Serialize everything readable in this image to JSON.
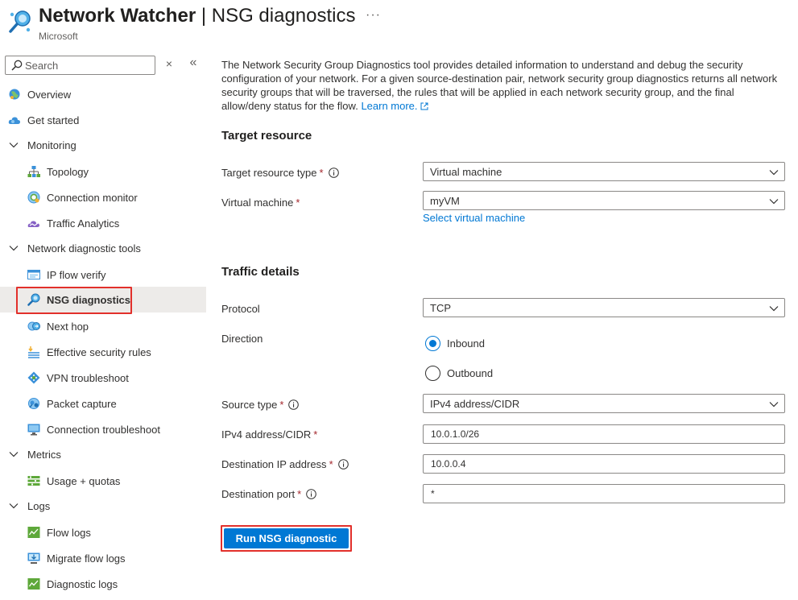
{
  "header": {
    "title_main": "Network Watcher",
    "title_sep": " | ",
    "title_blade": "NSG diagnostics",
    "more_label": "···",
    "subtitle": "Microsoft"
  },
  "sidebar": {
    "search_placeholder": "Search",
    "clear_label": "×",
    "collapse_label": "«",
    "items": [
      {
        "label": "Overview",
        "icon": "globe-icon"
      },
      {
        "label": "Get started",
        "icon": "cloud-icon"
      },
      {
        "label": "Monitoring",
        "icon": "chevron-down-icon"
      },
      {
        "label": "Topology",
        "icon": "topology-icon"
      },
      {
        "label": "Connection monitor",
        "icon": "connection-monitor-icon"
      },
      {
        "label": "Traffic Analytics",
        "icon": "traffic-analytics-icon"
      },
      {
        "label": "Network diagnostic tools",
        "icon": "chevron-down-icon"
      },
      {
        "label": "IP flow verify",
        "icon": "ip-flow-icon"
      },
      {
        "label": "NSG diagnostics",
        "icon": "nsg-diagnostics-icon",
        "selected": true
      },
      {
        "label": "Next hop",
        "icon": "next-hop-icon"
      },
      {
        "label": "Effective security rules",
        "icon": "security-rules-icon"
      },
      {
        "label": "VPN troubleshoot",
        "icon": "vpn-icon"
      },
      {
        "label": "Packet capture",
        "icon": "packet-capture-icon"
      },
      {
        "label": "Connection troubleshoot",
        "icon": "monitor-icon"
      },
      {
        "label": "Metrics",
        "icon": "chevron-down-icon"
      },
      {
        "label": "Usage + quotas",
        "icon": "usage-icon"
      },
      {
        "label": "Logs",
        "icon": "chevron-down-icon"
      },
      {
        "label": "Flow logs",
        "icon": "flow-logs-icon"
      },
      {
        "label": "Migrate flow logs",
        "icon": "migrate-icon"
      },
      {
        "label": "Diagnostic logs",
        "icon": "diagnostic-logs-icon"
      }
    ]
  },
  "content": {
    "intro": "The Network Security Group Diagnostics tool provides detailed information to understand and debug the security configuration of your network. For a given source-destination pair, network security group diagnostics returns all network security groups that will be traversed, the rules that will be applied in each network security group, and the final allow/deny status for the flow.",
    "learn_more": "Learn more.",
    "target_heading": "Target resource",
    "target_type_label": "Target resource type",
    "target_type_value": "Virtual machine",
    "vm_label": "Virtual machine",
    "vm_value": "myVM",
    "select_vm_link": "Select virtual machine",
    "traffic_heading": "Traffic details",
    "protocol_label": "Protocol",
    "protocol_value": "TCP",
    "direction_label": "Direction",
    "direction_options": [
      "Inbound",
      "Outbound"
    ],
    "source_type_label": "Source type",
    "source_type_value": "IPv4 address/CIDR",
    "ipv4_label": "IPv4 address/CIDR",
    "ipv4_value": "10.0.1.0/26",
    "dest_ip_label": "Destination IP address",
    "dest_ip_value": "10.0.0.4",
    "dest_port_label": "Destination port",
    "dest_port_value": "*",
    "required_mark": "*",
    "run_button": "Run NSG diagnostic"
  }
}
